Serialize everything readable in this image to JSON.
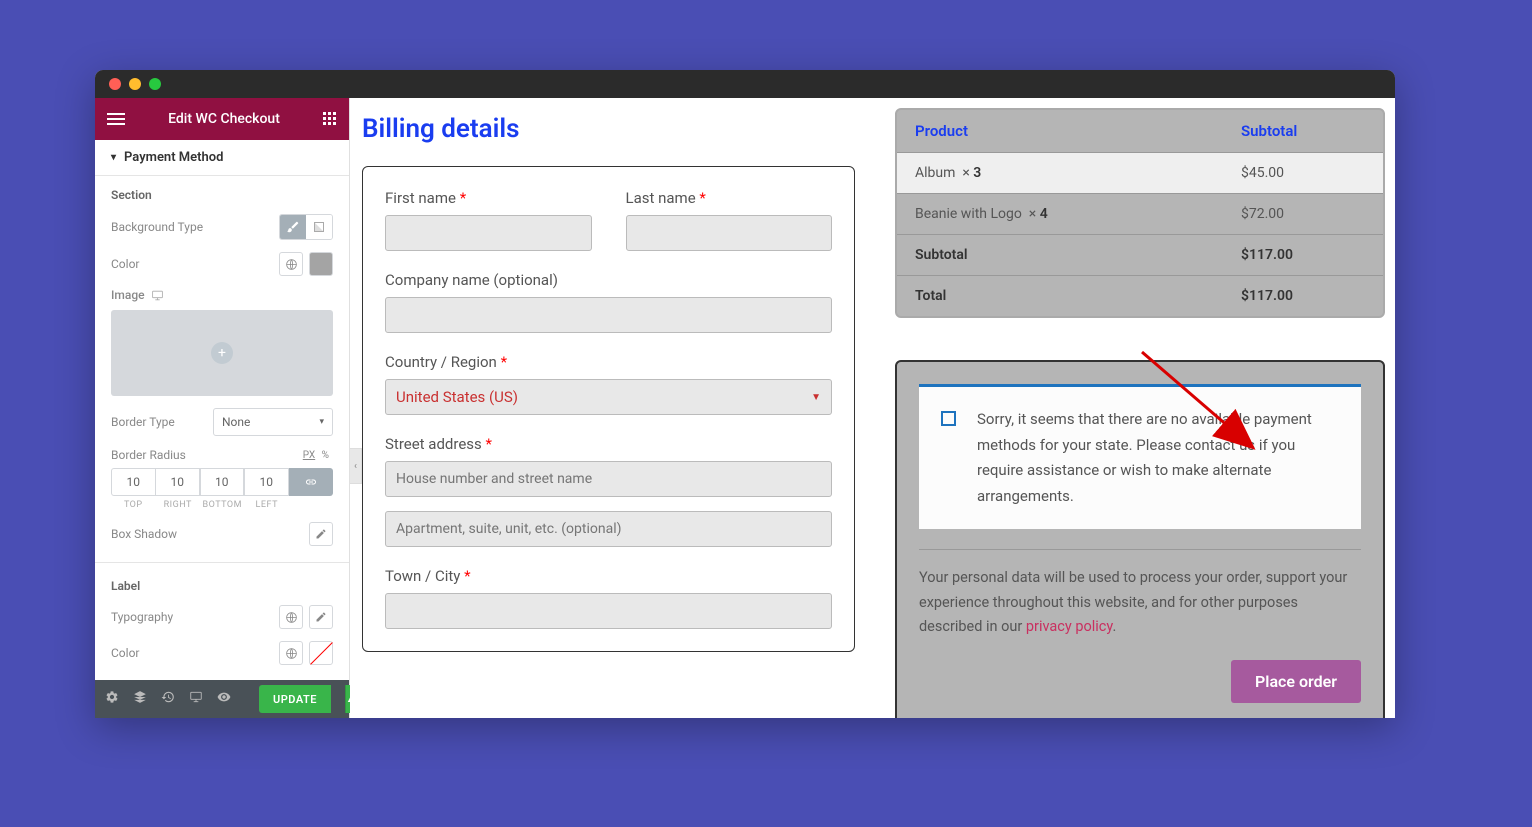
{
  "sidebar": {
    "title": "Edit WC Checkout",
    "section_title": "Payment Method",
    "labels": {
      "section": "Section",
      "background_type": "Background Type",
      "color": "Color",
      "image": "Image",
      "border_type": "Border Type",
      "border_radius": "Border Radius",
      "box_shadow": "Box Shadow",
      "label_section": "Label",
      "typography": "Typography",
      "color2": "Color"
    },
    "border_type_value": "None",
    "radius": {
      "top": "10",
      "right": "10",
      "bottom": "10",
      "left": "10"
    },
    "radius_labels": {
      "top": "TOP",
      "right": "RIGHT",
      "bottom": "BOTTOM",
      "left": "LEFT"
    },
    "units": {
      "px": "PX",
      "pct": "%"
    },
    "update_label": "UPDATE"
  },
  "billing": {
    "title": "Billing details",
    "first_name": "First name",
    "last_name": "Last name",
    "company": "Company name (optional)",
    "country": "Country / Region",
    "country_value": "United States (US)",
    "street": "Street address",
    "street_placeholder": "House number and street name",
    "street2_placeholder": "Apartment, suite, unit, etc. (optional)",
    "city": "Town / City"
  },
  "order": {
    "header_product": "Product",
    "header_subtotal": "Subtotal",
    "rows": [
      {
        "name": "Album",
        "qty": "3",
        "price": "$45.00"
      },
      {
        "name": "Beanie with Logo",
        "qty": "4",
        "price": "$72.00"
      }
    ],
    "subtotal_label": "Subtotal",
    "subtotal": "$117.00",
    "total_label": "Total",
    "total": "$117.00"
  },
  "payment": {
    "notice": "Sorry, it seems that there are no available payment methods for your state. Please contact us if you require assistance or wish to make alternate arrangements.",
    "privacy_pre": "Your personal data will be used to process your order, support your experience throughout this website, and for other purposes described in our ",
    "privacy_link": "privacy policy",
    "place_order": "Place order"
  }
}
